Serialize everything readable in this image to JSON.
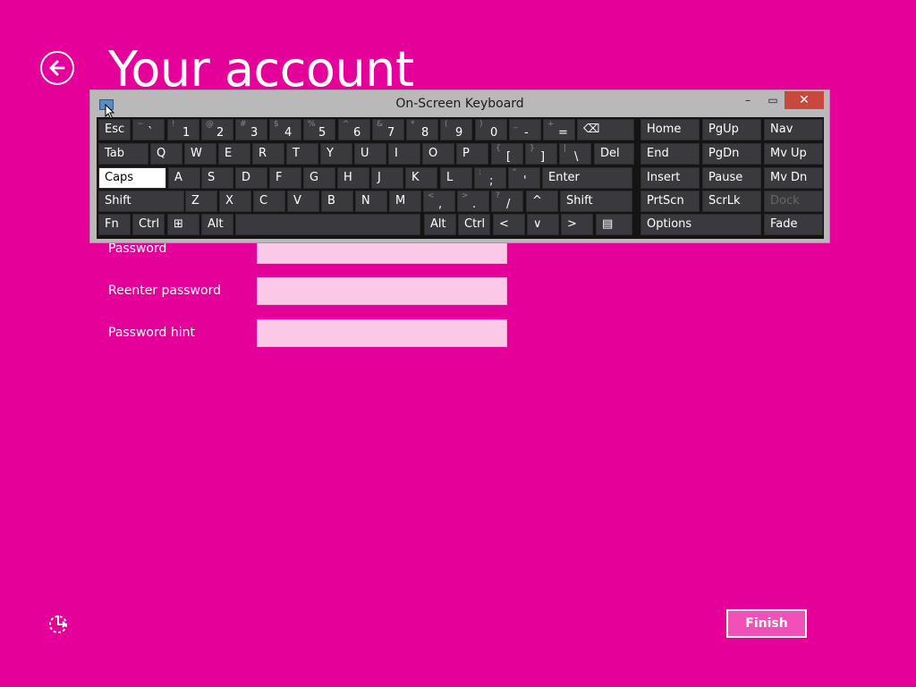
{
  "page": {
    "title": "Your account",
    "fields": [
      {
        "label": "Password",
        "value": ""
      },
      {
        "label": "Reenter password",
        "value": ""
      },
      {
        "label": "Password hint",
        "value": ""
      }
    ],
    "finish_label": "Finish",
    "background_color": "#e6009a"
  },
  "keyboard": {
    "title": "On-Screen Keyboard",
    "close_symbol": "✕",
    "minimize_symbol": "–",
    "maximize_symbol": "▭",
    "rows": [
      [
        {
          "label": "Esc"
        },
        {
          "shift": "~",
          "main": "`"
        },
        {
          "shift": "!",
          "main": "1"
        },
        {
          "shift": "@",
          "main": "2"
        },
        {
          "shift": "#",
          "main": "3"
        },
        {
          "shift": "$",
          "main": "4"
        },
        {
          "shift": "%",
          "main": "5"
        },
        {
          "shift": "^",
          "main": "6"
        },
        {
          "shift": "&",
          "main": "7"
        },
        {
          "shift": "*",
          "main": "8"
        },
        {
          "shift": "(",
          "main": "9"
        },
        {
          "shift": ")",
          "main": "0"
        },
        {
          "shift": "_",
          "main": "-"
        },
        {
          "shift": "+",
          "main": "="
        },
        {
          "label": "⌫"
        },
        {
          "label": "Home"
        },
        {
          "label": "PgUp"
        },
        {
          "label": "Nav"
        }
      ],
      [
        {
          "label": "Tab"
        },
        {
          "label": "Q"
        },
        {
          "label": "W"
        },
        {
          "label": "E"
        },
        {
          "label": "R"
        },
        {
          "label": "T"
        },
        {
          "label": "Y"
        },
        {
          "label": "U"
        },
        {
          "label": "I"
        },
        {
          "label": "O"
        },
        {
          "label": "P"
        },
        {
          "shift": "{",
          "main": "["
        },
        {
          "shift": "}",
          "main": "]"
        },
        {
          "shift": "|",
          "main": "\\"
        },
        {
          "label": "Del"
        },
        {
          "label": "End"
        },
        {
          "label": "PgDn"
        },
        {
          "label": "Mv Up"
        }
      ],
      [
        {
          "label": "Caps"
        },
        {
          "label": "A"
        },
        {
          "label": "S"
        },
        {
          "label": "D"
        },
        {
          "label": "F"
        },
        {
          "label": "G"
        },
        {
          "label": "H"
        },
        {
          "label": "J"
        },
        {
          "label": "K"
        },
        {
          "label": "L"
        },
        {
          "shift": ":",
          "main": ";"
        },
        {
          "shift": "\"",
          "main": "'"
        },
        {
          "label": "Enter"
        },
        {
          "label": "Insert"
        },
        {
          "label": "Pause"
        },
        {
          "label": "Mv Dn"
        }
      ],
      [
        {
          "label": "Shift"
        },
        {
          "label": "Z"
        },
        {
          "label": "X"
        },
        {
          "label": "C"
        },
        {
          "label": "V"
        },
        {
          "label": "B"
        },
        {
          "label": "N"
        },
        {
          "label": "M"
        },
        {
          "shift": "<",
          "main": ","
        },
        {
          "shift": ">",
          "main": "."
        },
        {
          "shift": "?",
          "main": "/"
        },
        {
          "label": "^"
        },
        {
          "label": "Shift"
        },
        {
          "label": "PrtScn"
        },
        {
          "label": "ScrLk"
        },
        {
          "label": "Dock"
        }
      ],
      [
        {
          "label": "Fn"
        },
        {
          "label": "Ctrl"
        },
        {
          "label": "⊞"
        },
        {
          "label": "Alt"
        },
        {
          "label": ""
        },
        {
          "label": "Alt"
        },
        {
          "label": "Ctrl"
        },
        {
          "label": "<"
        },
        {
          "label": "∨"
        },
        {
          "label": ">"
        },
        {
          "label": "▤"
        },
        {
          "label": "Options"
        },
        {
          "label": "Fade"
        }
      ]
    ]
  }
}
